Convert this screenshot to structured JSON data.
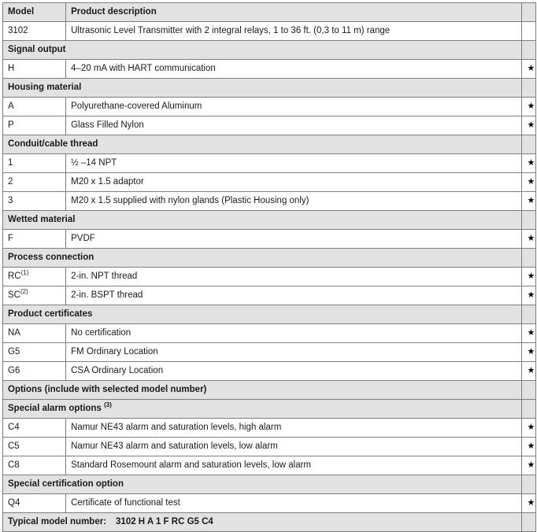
{
  "table": {
    "columns": {
      "model": "Model",
      "description": "Product description",
      "star": ""
    },
    "star_glyph": "★",
    "rows": [
      {
        "kind": "item",
        "model": "3102",
        "description": "Ultrasonic Level Transmitter with 2 integral relays, 1 to 36 ft. (0,3 to 11 m) range",
        "star": false
      },
      {
        "kind": "section",
        "label": "Signal output",
        "star": false
      },
      {
        "kind": "item",
        "model": "H",
        "description": "4–20 mA with HART communication",
        "star": true
      },
      {
        "kind": "section",
        "label": "Housing material",
        "star": false
      },
      {
        "kind": "item",
        "model": "A",
        "description": "Polyurethane-covered Aluminum",
        "star": true
      },
      {
        "kind": "item",
        "model": "P",
        "description": "Glass Filled Nylon",
        "star": true
      },
      {
        "kind": "section",
        "label": "Conduit/cable thread",
        "star": false
      },
      {
        "kind": "item",
        "model": "1",
        "description": "½ –14 NPT",
        "star": true
      },
      {
        "kind": "item",
        "model": "2",
        "description": "M20 x 1.5 adaptor",
        "star": true
      },
      {
        "kind": "item",
        "model": "3",
        "description": "M20 x 1.5 supplied with nylon glands (Plastic Housing only)",
        "star": true
      },
      {
        "kind": "section",
        "label": "Wetted material",
        "star": false
      },
      {
        "kind": "item",
        "model": "F",
        "description": "PVDF",
        "star": true
      },
      {
        "kind": "section",
        "label": "Process connection",
        "star": false
      },
      {
        "kind": "item",
        "model": "RC",
        "model_sup": "(1)",
        "description": "2-in. NPT thread",
        "star": true
      },
      {
        "kind": "item",
        "model": "SC",
        "model_sup": "(2)",
        "description": "2-in. BSPT thread",
        "star": true
      },
      {
        "kind": "section",
        "label": "Product certificates",
        "star": false
      },
      {
        "kind": "item",
        "model": "NA",
        "description": "No certification",
        "star": true
      },
      {
        "kind": "item",
        "model": "G5",
        "description": "FM Ordinary Location",
        "star": true
      },
      {
        "kind": "item",
        "model": "G6",
        "description": "CSA Ordinary Location",
        "star": true
      },
      {
        "kind": "section",
        "label": "Options (include with selected model number)",
        "star": false
      },
      {
        "kind": "section",
        "label": "Special alarm options ",
        "label_sup": "(3)",
        "star": false
      },
      {
        "kind": "item",
        "model": "C4",
        "description": "Namur NE43 alarm and saturation levels, high alarm",
        "star": true
      },
      {
        "kind": "item",
        "model": "C5",
        "description": "Namur NE43 alarm and saturation levels, low alarm",
        "star": true
      },
      {
        "kind": "item",
        "model": "C8",
        "description": "Standard Rosemount alarm and saturation levels, low alarm",
        "star": true
      },
      {
        "kind": "section",
        "label": "Special certification option",
        "star": false
      },
      {
        "kind": "item",
        "model": "Q4",
        "description": "Certificate of functional test",
        "star": true
      },
      {
        "kind": "footer",
        "label": "Typical model number:",
        "value": "3102 H A 1 F RC G5 C4",
        "star": false
      }
    ]
  },
  "colors": {
    "band": "#e2e2e2",
    "border": "#7d7d7d",
    "text": "#1a1a1a",
    "page": "#ffffff"
  }
}
